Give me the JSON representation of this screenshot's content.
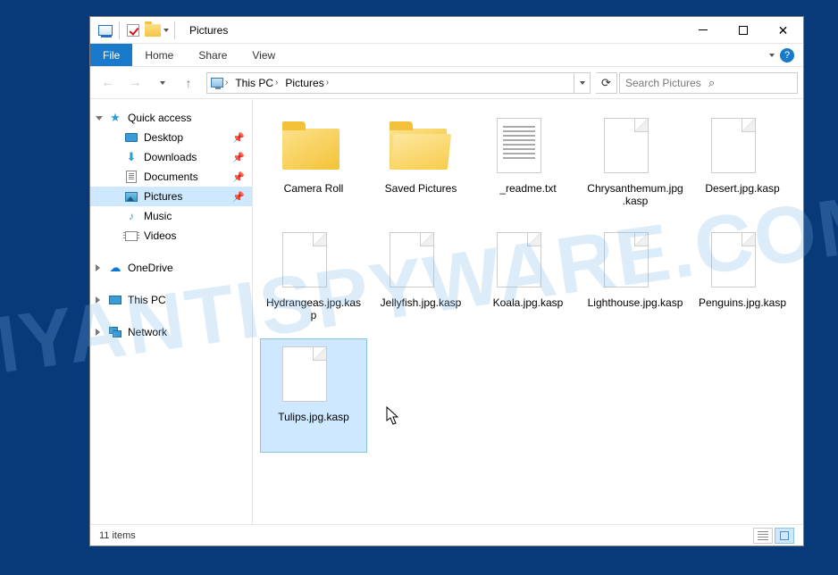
{
  "title": "Pictures",
  "ribbon": {
    "file": "File",
    "tabs": [
      "Home",
      "Share",
      "View"
    ]
  },
  "nav": {
    "breadcrumb": [
      "This PC",
      "Pictures"
    ],
    "search_placeholder": "Search Pictures"
  },
  "sidebar": {
    "quick_access": "Quick access",
    "items": [
      {
        "label": "Desktop",
        "icon": "desktop",
        "pinned": true
      },
      {
        "label": "Downloads",
        "icon": "downloads",
        "pinned": true
      },
      {
        "label": "Documents",
        "icon": "documents",
        "pinned": true
      },
      {
        "label": "Pictures",
        "icon": "pictures",
        "pinned": true,
        "selected": true
      },
      {
        "label": "Music",
        "icon": "music",
        "pinned": false
      },
      {
        "label": "Videos",
        "icon": "videos",
        "pinned": false
      }
    ],
    "onedrive": "OneDrive",
    "thispc": "This PC",
    "network": "Network"
  },
  "files": [
    {
      "name": "Camera Roll",
      "type": "folder"
    },
    {
      "name": "Saved Pictures",
      "type": "folder-open"
    },
    {
      "name": "_readme.txt",
      "type": "txt"
    },
    {
      "name": "Chrysanthemum.jpg.kasp",
      "type": "blank"
    },
    {
      "name": "Desert.jpg.kasp",
      "type": "blank"
    },
    {
      "name": "Hydrangeas.jpg.kasp",
      "type": "blank"
    },
    {
      "name": "Jellyfish.jpg.kasp",
      "type": "blank"
    },
    {
      "name": "Koala.jpg.kasp",
      "type": "blank"
    },
    {
      "name": "Lighthouse.jpg.kasp",
      "type": "blank"
    },
    {
      "name": "Penguins.jpg.kasp",
      "type": "blank"
    },
    {
      "name": "Tulips.jpg.kasp",
      "type": "blank",
      "selected": true
    }
  ],
  "status": {
    "count": "11 items"
  },
  "watermark": "MYANTISPYWARE.COM"
}
